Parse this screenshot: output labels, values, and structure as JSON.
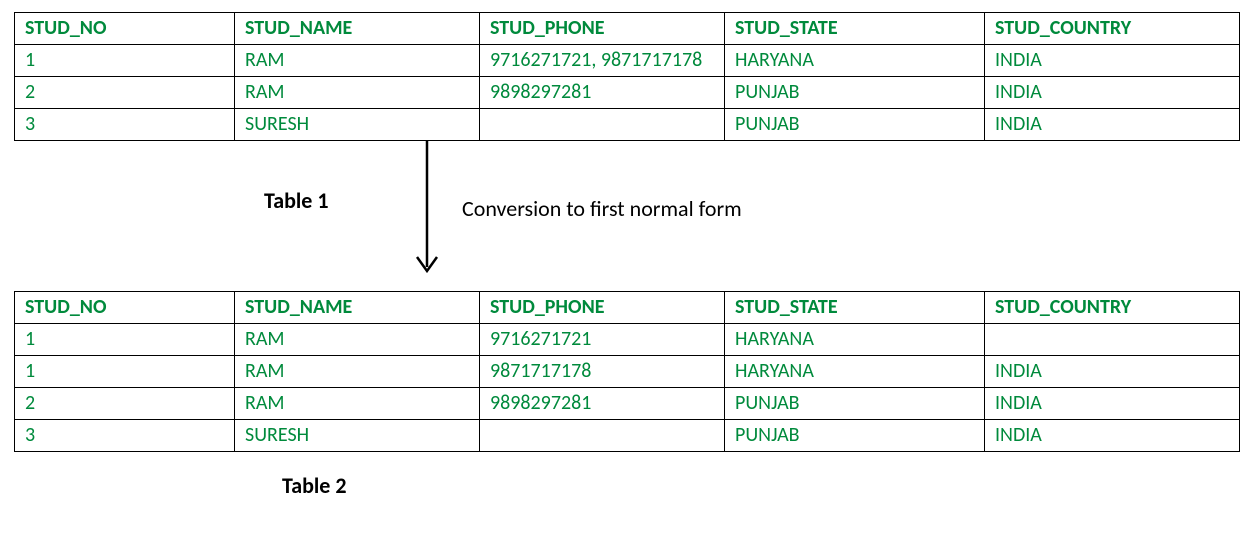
{
  "headers": {
    "stud_no": "STUD_NO",
    "stud_name": "STUD_NAME",
    "stud_phone": "STUD_PHONE",
    "stud_state": "STUD_STATE",
    "stud_country": "STUD_COUNTRY"
  },
  "table1": {
    "caption": "Table 1",
    "rows": [
      {
        "no": "1",
        "name": "RAM",
        "phone": "9716271721, 9871717178",
        "state": "HARYANA",
        "country": "INDIA"
      },
      {
        "no": "2",
        "name": "RAM",
        "phone": "9898297281",
        "state": "PUNJAB",
        "country": "INDIA"
      },
      {
        "no": "3",
        "name": "SURESH",
        "phone": "",
        "state": "PUNJAB",
        "country": "INDIA"
      }
    ]
  },
  "conversion_label": "Conversion to first normal form",
  "table2": {
    "caption": "Table 2",
    "rows": [
      {
        "no": "1",
        "name": "RAM",
        "phone": "9716271721",
        "state": "HARYANA",
        "country": ""
      },
      {
        "no": "1",
        "name": "RAM",
        "phone": "9871717178",
        "state": "HARYANA",
        "country": "INDIA"
      },
      {
        "no": "2",
        "name": "RAM",
        "phone": "9898297281",
        "state": "PUNJAB",
        "country": "INDIA"
      },
      {
        "no": "3",
        "name": "SURESH",
        "phone": "",
        "state": "PUNJAB",
        "country": "INDIA"
      }
    ]
  }
}
